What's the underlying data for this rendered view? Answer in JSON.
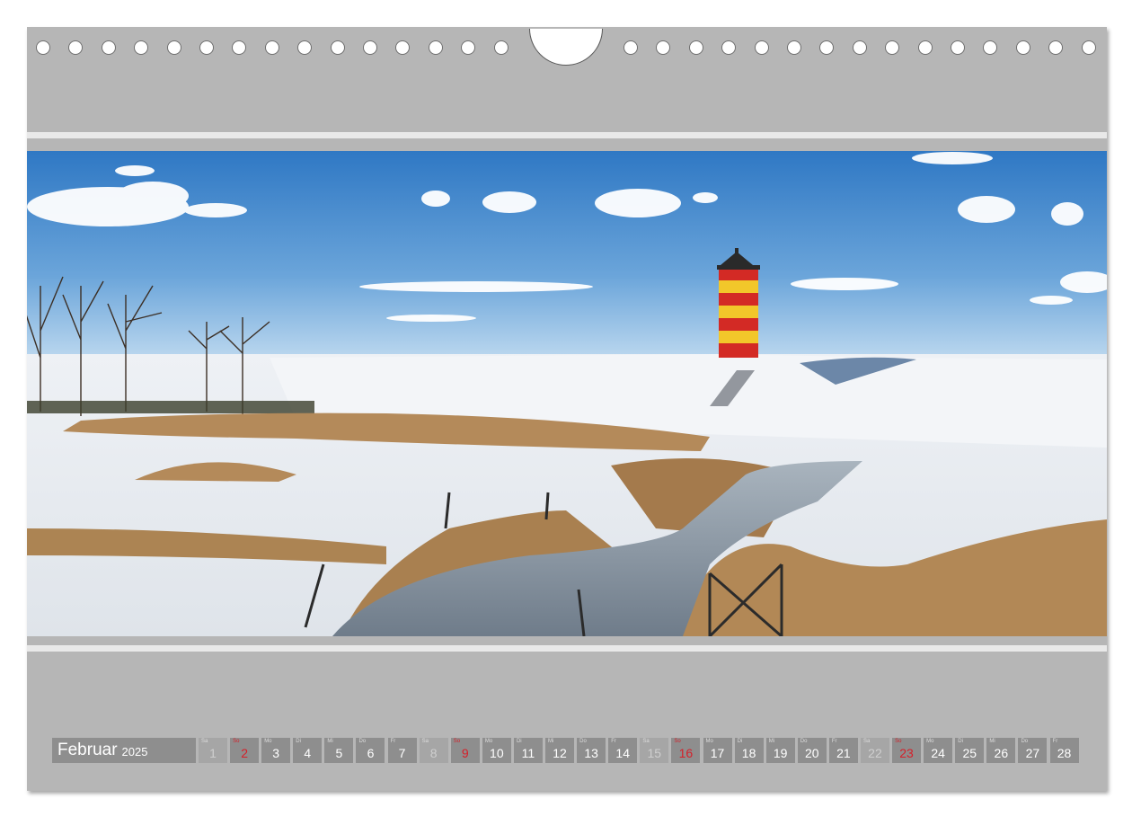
{
  "calendar": {
    "month": "Februar",
    "year": "2025",
    "days": [
      {
        "num": "1",
        "dow": "Sa",
        "type": "weekend"
      },
      {
        "num": "2",
        "dow": "So",
        "type": "holiday"
      },
      {
        "num": "3",
        "dow": "Mo",
        "type": "weekday"
      },
      {
        "num": "4",
        "dow": "Di",
        "type": "weekday"
      },
      {
        "num": "5",
        "dow": "Mi",
        "type": "weekday"
      },
      {
        "num": "6",
        "dow": "Do",
        "type": "weekday"
      },
      {
        "num": "7",
        "dow": "Fr",
        "type": "weekday"
      },
      {
        "num": "8",
        "dow": "Sa",
        "type": "weekend"
      },
      {
        "num": "9",
        "dow": "So",
        "type": "holiday"
      },
      {
        "num": "10",
        "dow": "Mo",
        "type": "weekday"
      },
      {
        "num": "11",
        "dow": "Di",
        "type": "weekday"
      },
      {
        "num": "12",
        "dow": "Mi",
        "type": "weekday"
      },
      {
        "num": "13",
        "dow": "Do",
        "type": "weekday"
      },
      {
        "num": "14",
        "dow": "Fr",
        "type": "weekday"
      },
      {
        "num": "15",
        "dow": "Sa",
        "type": "weekend"
      },
      {
        "num": "16",
        "dow": "So",
        "type": "holiday"
      },
      {
        "num": "17",
        "dow": "Mo",
        "type": "weekday"
      },
      {
        "num": "18",
        "dow": "Di",
        "type": "weekday"
      },
      {
        "num": "19",
        "dow": "Mi",
        "type": "weekday"
      },
      {
        "num": "20",
        "dow": "Do",
        "type": "weekday"
      },
      {
        "num": "21",
        "dow": "Fr",
        "type": "weekday"
      },
      {
        "num": "22",
        "dow": "Sa",
        "type": "weekend"
      },
      {
        "num": "23",
        "dow": "So",
        "type": "holiday"
      },
      {
        "num": "24",
        "dow": "Mo",
        "type": "weekday"
      },
      {
        "num": "25",
        "dow": "Di",
        "type": "weekday"
      },
      {
        "num": "26",
        "dow": "Mi",
        "type": "weekday"
      },
      {
        "num": "27",
        "dow": "Do",
        "type": "weekday"
      },
      {
        "num": "28",
        "dow": "Fr",
        "type": "weekday"
      }
    ]
  },
  "photo": {
    "subject": "lighthouse-on-snowy-dike",
    "colors": {
      "sky_top": "#2f78c4",
      "sky_bottom": "#b9d6ee",
      "snow": "#f2f4f7",
      "reed": "#b48a5a",
      "tower_red": "#d32a25",
      "tower_yellow": "#f2c72a",
      "water": "#7e8b98"
    }
  },
  "colors": {
    "page_bg": "#b6b6b6",
    "day_cell": "#8e8e8e",
    "weekend_cell": "#a6a6a6",
    "holiday_text": "#d5202a"
  }
}
